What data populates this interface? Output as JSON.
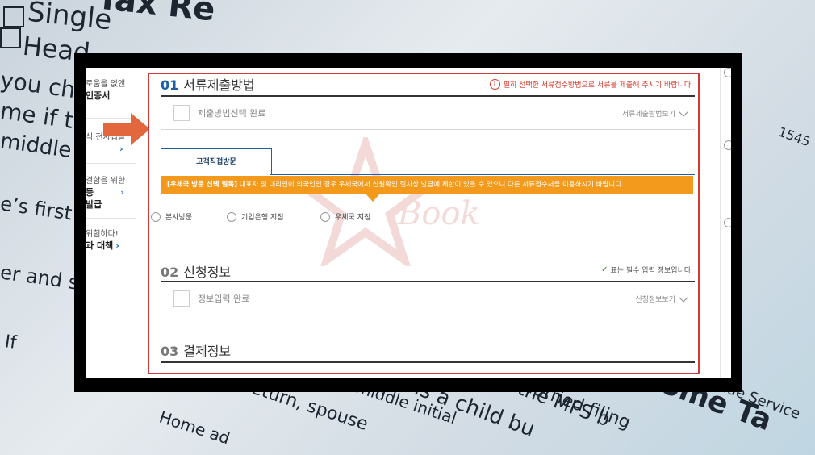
{
  "background": {
    "texts": [
      "Single",
      "Head",
      "you che",
      "me if th",
      "middle",
      "e’s first n",
      "er and s",
      "If",
      "Tax Re",
      "return, spouse",
      "Home ad",
      "d middle initial",
      "is a child bu",
      "ked the MFS b",
      "Married filing",
      "ncome Ta",
      "evenue Service",
      "1545"
    ]
  },
  "sidebar": {
    "items": [
      {
        "line1": "로움을 없앤",
        "line2": "인증서"
      },
      {
        "line1": "식 전자입찰",
        "line2": ""
      },
      {
        "line1": "결함을 위한",
        "line2": "등",
        "line3": "발급"
      },
      {
        "line1": "위험하다!",
        "line2": "과 대책"
      }
    ],
    "arrow": "›"
  },
  "sections": {
    "s1": {
      "num": "01",
      "title": "서류제출방법",
      "notice": "필히 선택한 서류접수방법으로 서류를 제출해 주시기 바랍니다.",
      "check_label": "제출방법선택 완료",
      "view_label": "서류제출방법보기"
    },
    "tab": {
      "label": "고객직접방문"
    },
    "orange_notice": {
      "bold": "[우체국 방문 선택 필독]",
      "text": " 대표자 및 대리인이 외국인인 경우 우체국에서 신원확인 절차상 발급에 제한이 있을 수 있으니 다른 서류접수처를 이용하시기 바랍니다."
    },
    "radios": [
      "본사방문",
      "기업은행 지점",
      "우체국 지점"
    ],
    "s2": {
      "num": "02",
      "title": "신청정보",
      "required_note": "표는 필수 입력 정보입니다.",
      "check_label": "정보입력 완료",
      "view_label": "신청정보보기"
    },
    "s3": {
      "num": "03",
      "title": "결제정보"
    }
  },
  "watermark": {
    "text": "Book"
  },
  "colors": {
    "accent_blue": "#1a5fa8",
    "border_red": "#d23a3a",
    "notice_orange": "#f39a1c",
    "pointer": "#e2673c"
  }
}
